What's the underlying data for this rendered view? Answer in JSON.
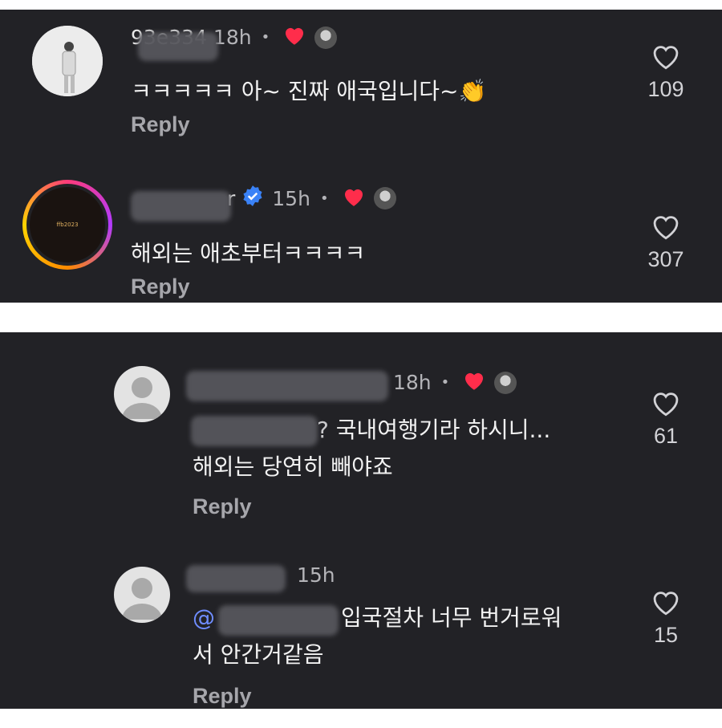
{
  "comments": [
    {
      "username_partial": "93e334",
      "time": "18h",
      "separator": "•",
      "text": "ㅋㅋㅋㅋㅋ 아~ 진짜 애국입니다~",
      "emoji": "👏",
      "reply_label": "Reply",
      "likes": "109"
    },
    {
      "username_partial": "r",
      "time": "15h",
      "separator": "•",
      "verified": true,
      "avatar_text": "ffb2023",
      "text": "해외는 애초부터ㅋㅋㅋㅋ",
      "reply_label": "Reply",
      "likes": "307"
    },
    {
      "time": "18h",
      "separator": "•",
      "mention_partial": "?",
      "text_line1": "국내여행기라 하시니...",
      "text_line2": "해외는 당연히 빼야죠",
      "reply_label": "Reply",
      "likes": "61"
    },
    {
      "time": "15h",
      "mention_partial": "@",
      "text_line1": "입국절차 너무 번거로워",
      "text_line2": "서 안간거같음",
      "reply_label": "Reply",
      "likes": "15"
    }
  ],
  "colors": {
    "background": "#222226",
    "liked_heart": "#ff2d4b",
    "verified_badge": "#3a82f7"
  },
  "icons": {
    "like": "heart-outline-icon",
    "creator_liked": "heart-filled-icon",
    "verified": "verified-badge-icon"
  }
}
